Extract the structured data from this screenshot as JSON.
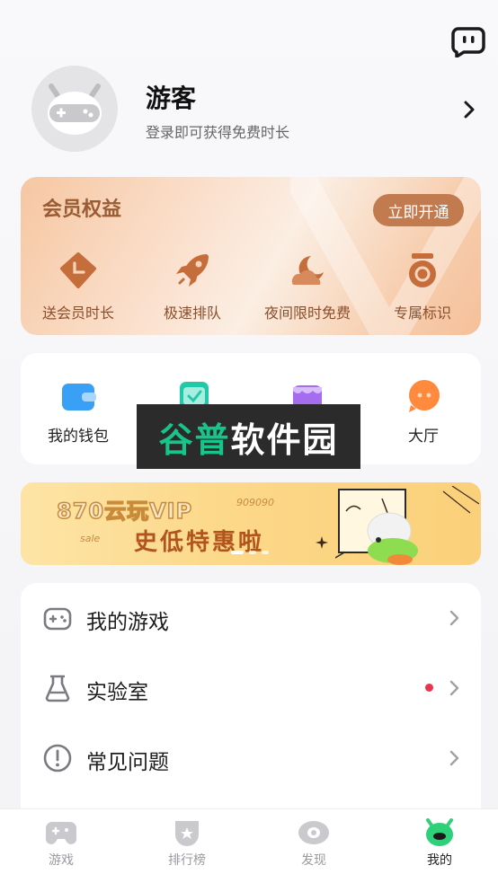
{
  "profile": {
    "name": "游客",
    "subtitle": "登录即可获得免费时长"
  },
  "member": {
    "title": "会员权益",
    "open_label": "立即开通",
    "benefits": [
      {
        "label": "送会员时长",
        "icon": "clock-badge-icon"
      },
      {
        "label": "极速排队",
        "icon": "rocket-icon"
      },
      {
        "label": "夜间限时免费",
        "icon": "moon-cloud-icon"
      },
      {
        "label": "专属标识",
        "icon": "medal-icon"
      }
    ]
  },
  "shortcuts": [
    {
      "label": "我的钱包",
      "icon": "wallet-icon",
      "color": "#3aa0f5"
    },
    {
      "label": "",
      "icon": "checklist-icon",
      "color": "#22c9a8"
    },
    {
      "label": "",
      "icon": "shop-icon",
      "color": "#a66cf0"
    },
    {
      "label": "大厅",
      "icon": "chat-bubble-icon",
      "color": "#ff8a3d"
    }
  ],
  "watermark": {
    "green": "谷普",
    "white": "软件园"
  },
  "banner": {
    "line1": "870云玩VIP",
    "line2": "史低特惠啦",
    "sale": "sale",
    "code": "909090"
  },
  "menu": [
    {
      "label": "我的游戏",
      "icon": "gamepad-icon",
      "badge": false
    },
    {
      "label": "实验室",
      "icon": "flask-icon",
      "badge": true
    },
    {
      "label": "常见问题",
      "icon": "exclamation-circle-icon",
      "badge": false
    }
  ],
  "nav": [
    {
      "label": "游戏",
      "icon": "gamepad-icon",
      "active": false
    },
    {
      "label": "排行榜",
      "icon": "ranking-shield-icon",
      "active": false
    },
    {
      "label": "发现",
      "icon": "eye-icon",
      "active": false
    },
    {
      "label": "我的",
      "icon": "monster-face-icon",
      "active": true
    }
  ],
  "colors": {
    "accent_green": "#2fd07a",
    "member_brown": "#c27a4f",
    "badge_red": "#e8354b"
  }
}
